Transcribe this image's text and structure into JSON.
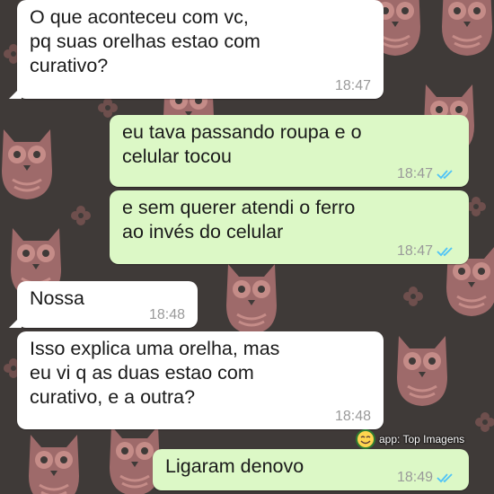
{
  "chat": {
    "messages": [
      {
        "direction": "incoming",
        "text": "O que aconteceu com vc,\npq suas orelhas estao com\ncurativo?",
        "time": "18:47"
      },
      {
        "direction": "outgoing",
        "text": "eu tava passando roupa e o\ncelular tocou",
        "time": "18:47",
        "status": "read"
      },
      {
        "direction": "outgoing",
        "text": "e sem querer atendi o ferro\nao invés do celular",
        "time": "18:47",
        "status": "read"
      },
      {
        "direction": "incoming",
        "text": "Nossa",
        "time": "18:48"
      },
      {
        "direction": "incoming",
        "text": "Isso explica uma orelha, mas\neu vi q as duas estao com\ncurativo, e a outra?",
        "time": "18:48"
      },
      {
        "direction": "outgoing",
        "text": "Ligaram denovo",
        "time": "18:49",
        "status": "read"
      }
    ]
  },
  "watermark": {
    "text": "app: Top Imagens",
    "icon": "smiley-icon"
  },
  "colors": {
    "incoming_bubble": "#ffffff",
    "outgoing_bubble": "#dcf8c6",
    "timestamp": "#9a9a9a",
    "read_ticks": "#4fc3f7",
    "wallpaper_bg": "#3f3a38",
    "owl_pink": "#9e6a6a"
  }
}
